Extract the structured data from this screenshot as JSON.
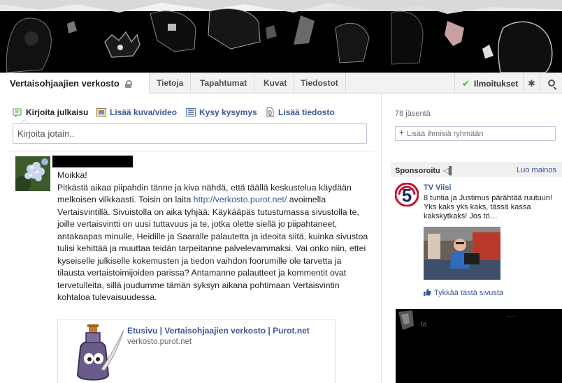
{
  "header": {
    "group_name": "Vertaisohjaajien verkosto",
    "tabs": [
      {
        "label": "Tietoja"
      },
      {
        "label": "Tapahtumat"
      },
      {
        "label": "Kuvat"
      },
      {
        "label": "Tiedostot"
      }
    ],
    "notifications_label": "Ilmoitukset"
  },
  "composer": {
    "actions": [
      {
        "label": "Kirjoita julkaisu",
        "icon": "pencil-icon"
      },
      {
        "label": "Lisää kuva/video",
        "icon": "photo-icon"
      },
      {
        "label": "Kysy kysymys",
        "icon": "question-list-icon"
      },
      {
        "label": "Lisää tiedosto",
        "icon": "file-icon"
      }
    ],
    "placeholder": "Kirjoita jotain.."
  },
  "post": {
    "greeting": "Moikka!",
    "text_before_link": "Pitkästä aikaa piipahdin tänne ja kiva nähdä, että täällä keskustelua käydään melkoisen vilkkaasti. Toisin on laita ",
    "link": "http://verkosto.purot.net/",
    "text_after_link": " avoimella Vertaisvintillä. Sivuistolla on aika tyhjää. Käykääpäs tutustumassa sivustolla te, joille vertaisvintti on uusi tuttavuus ja te, jotka olette siellä jo piipahtaneet, antakaapas minulle, Heidille ja Saaralle palautetta ja ideoita siitä, kuinka sivustoa tulisi kehittää ja muuttaa teidän tarpeitanne palvelevammaksi. Vai onko niin, ettei kyseiselle julkiselle kokemusten ja tiedon vaihdon foorumille ole tarvetta ja tilausta vertaistoimijoiden parissa? Antamanne palautteet ja kommentit ovat tervetulleita, sillä joudumme tämän syksyn aikana pohtimaan Vertaisvintin kohtaloa tulevaisuudessa.",
    "share": {
      "title": "Etusivu | Vertaisohjaajien verkosto | Purot.net",
      "url": "verkosto.purot.net"
    }
  },
  "sidebar": {
    "members": "78 jäsentä",
    "add_people_placeholder": "Lisää ihmisiä ryhmään",
    "sponsored_label": "Sponsoroitu",
    "create_ad": "Luo mainos",
    "ad": {
      "title": "TV Viisi",
      "text": "8 tuntia ja Justimus pärähtää ruutuun! Yks kaks yks kaks, tässä kassa kakskytkaks! Jos tö…",
      "like_label": "Tykkää tästä sivusta",
      "logo_number": "5"
    },
    "ad2": {
      "text1": "ta",
      "text2": "...."
    }
  },
  "colors": {
    "link": "#3b5998",
    "tabbar_bg": "#f2f2f2",
    "check": "#42b72a"
  }
}
